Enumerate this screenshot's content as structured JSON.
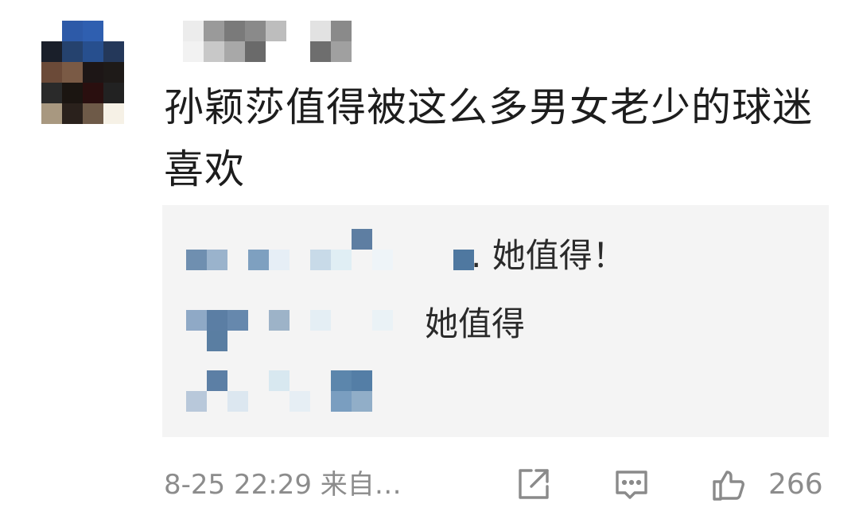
{
  "comment": {
    "text": "孙颖莎值得被这么多男女老少的球迷喜欢",
    "replies": [
      {
        "text": ". 她值得！"
      },
      {
        "text": "她值得"
      },
      {
        "text": ""
      }
    ],
    "timestamp": "8-25 22:29",
    "source": "来自…",
    "like_count": "266"
  },
  "icons": {
    "share": "share-icon",
    "comment": "comment-icon",
    "like": "thumbs-up-icon"
  },
  "colors": {
    "muted_text": "#8c8c8c",
    "reply_bg": "#f4f4f4",
    "mosaic_blue": "#5a82a8"
  }
}
